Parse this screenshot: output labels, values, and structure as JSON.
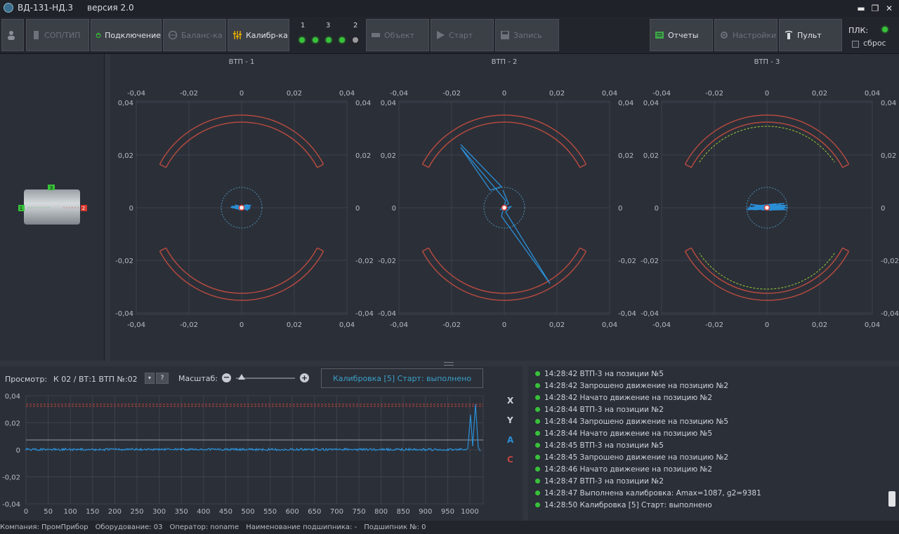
{
  "title": {
    "app": "ВД-131-НД.3",
    "version": "версия 2.0"
  },
  "toolbar": {
    "items": [
      {
        "label": "СОП/ТИП",
        "enabled": false,
        "icon": "sop-icon"
      },
      {
        "label": "Подключение",
        "enabled": true,
        "icon": "power-icon"
      },
      {
        "label": "Баланс-ка",
        "enabled": false,
        "icon": "balance-icon"
      },
      {
        "label": "Калибр-ка",
        "enabled": true,
        "icon": "calibration-icon"
      },
      {
        "label": "Объект",
        "enabled": false,
        "icon": "object-icon"
      },
      {
        "label": "Старт",
        "enabled": false,
        "icon": "play-icon"
      },
      {
        "label": "Запись",
        "enabled": false,
        "icon": "save-icon"
      },
      {
        "label": "Отчеты",
        "enabled": true,
        "icon": "reports-icon"
      },
      {
        "label": "Настройки",
        "enabled": false,
        "icon": "gear-icon"
      },
      {
        "label": "Пульт",
        "enabled": true,
        "icon": "remote-icon"
      }
    ],
    "leds_labels": [
      "1",
      "3",
      "2"
    ],
    "plk_label": "ПЛК:",
    "reset_label": "сброс",
    "colors": {
      "led_on": "#38c23a",
      "led_off": "#9a9a9a"
    }
  },
  "sensor": {
    "labels": [
      "3",
      "1",
      "2"
    ]
  },
  "plots": [
    {
      "title": "ВТП - 1"
    },
    {
      "title": "ВТП - 2"
    },
    {
      "title": "ВТП - 3"
    }
  ],
  "plot_ticks": [
    "-0,04",
    "-0,02",
    "0",
    "0,02",
    "0,04"
  ],
  "bottom": {
    "view_label": "Просмотр:",
    "view_value": "К 02 / ВТ:1  ВТП №:02",
    "help_label": "?",
    "scale_label": "Масштаб:",
    "status_box": "Калибровка [5] Старт: выполнено",
    "series_labels": [
      "X",
      "Y",
      "A",
      "C"
    ],
    "series_colors": [
      "#b9bdc4",
      "#b9bdc4",
      "#2a8fd6",
      "#c0453d"
    ],
    "y_ticks": [
      "0,04",
      "0,02",
      "0",
      "-0,02",
      "-0,04"
    ],
    "x_ticks": [
      "0",
      "50",
      "100",
      "150",
      "200",
      "250",
      "300",
      "350",
      "400",
      "450",
      "500",
      "550",
      "600",
      "650",
      "700",
      "750",
      "800",
      "850",
      "900",
      "950",
      "1000"
    ]
  },
  "log": [
    "14:28:42 ВТП-3 на позиции №5",
    "14:28:42 Запрошено движение на позицию №2",
    "14:28:42 Начато движение на позицию №2",
    "14:28:44 ВТП-3 на позиции №2",
    "14:28:44 Запрошено движение на позицию №5",
    "14:28:44 Начато движение на позицию №5",
    "14:28:45 ВТП-3 на позиции №5",
    "14:28:45 Запрошено движение на позицию №2",
    "14:28:46 Начато движение на позицию №2",
    "14:28:47 ВТП-3 на позиции №2",
    "14:28:47 Выполнена калибровка:  Amax=1087, g2=9381",
    "14:28:50 Калибровка [5] Старт: выполнено"
  ],
  "statusbar": {
    "company": "Компания: ПромПрибор",
    "equipment": "Оборудование: 03",
    "operator": "Оператор: noname",
    "bearing_name": "Наименование подшипника: -",
    "bearing_no": "Подшипник №: 0"
  }
}
